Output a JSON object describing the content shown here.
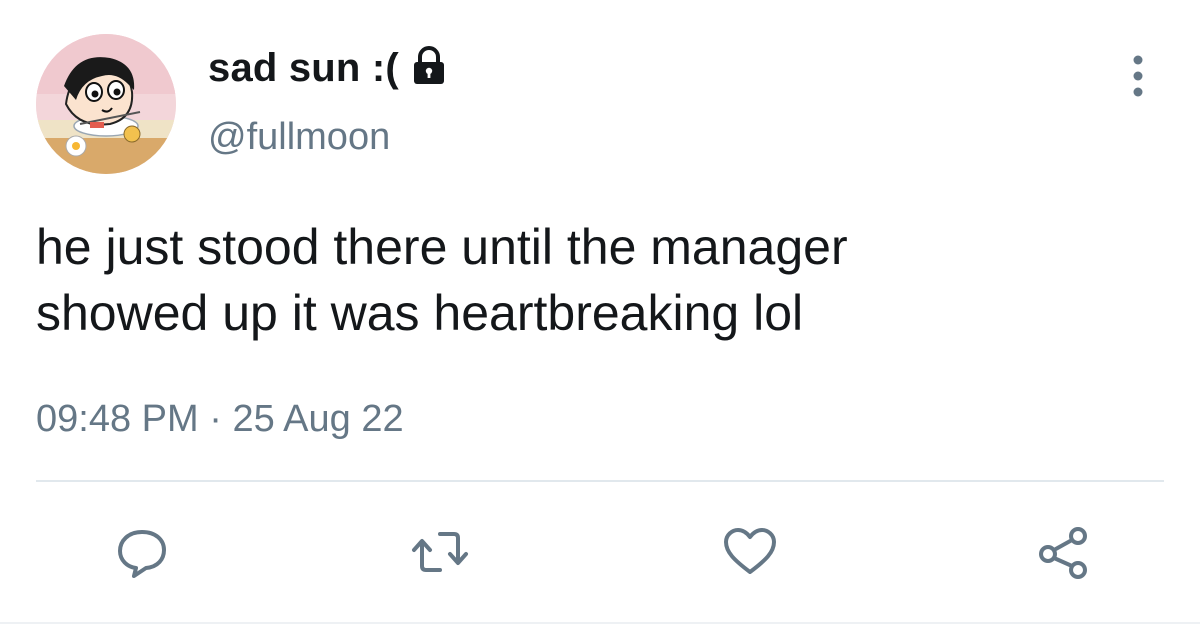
{
  "user": {
    "display_name": "sad sun :(",
    "handle": "@fullmoon",
    "protected_icon": "lock-icon",
    "avatar_icon": "cartoon-avatar"
  },
  "tweet": {
    "text": "he just stood there until the manager\nshowed up it was heartbreaking lol",
    "time": "09:48 PM",
    "separator": " · ",
    "date": "25 Aug 22"
  },
  "header": {
    "more_icon": "more-vertical-icon"
  },
  "actions": [
    {
      "icon": "reply-icon"
    },
    {
      "icon": "retweet-icon"
    },
    {
      "icon": "like-icon"
    },
    {
      "icon": "share-icon"
    }
  ],
  "colors": {
    "primary_text": "#14171a",
    "secondary_text": "#657786",
    "divider": "#e1e8ed",
    "icon": "#657786"
  }
}
